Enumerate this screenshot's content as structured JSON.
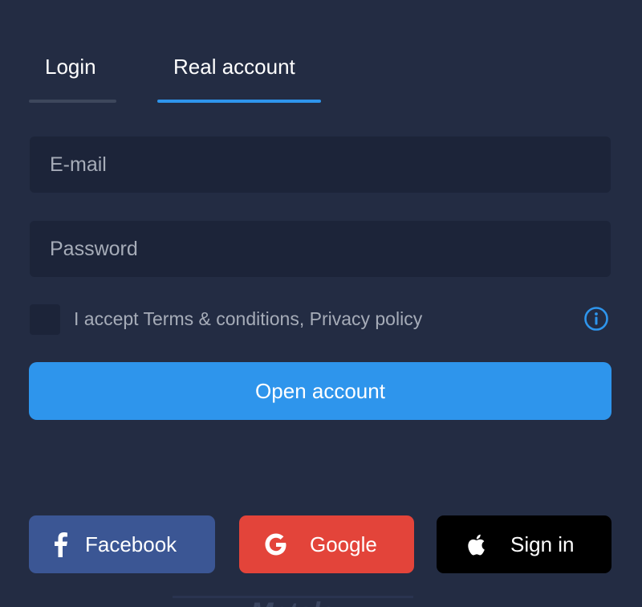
{
  "tabs": [
    {
      "label": "Login",
      "active": false
    },
    {
      "label": "Real account",
      "active": true
    }
  ],
  "form": {
    "email": {
      "placeholder": "E-mail",
      "value": ""
    },
    "password": {
      "placeholder": "Password",
      "value": ""
    },
    "terms": {
      "label": "I accept Terms & conditions, Privacy policy",
      "checked": false
    },
    "submit_label": "Open account"
  },
  "social": {
    "facebook": {
      "label": "Facebook",
      "icon": "facebook-icon",
      "color": "#3b5694"
    },
    "google": {
      "label": "Google",
      "icon": "google-icon",
      "color": "#e3443a"
    },
    "apple": {
      "label": "Sign in",
      "icon": "apple-icon",
      "color": "#000000"
    }
  },
  "colors": {
    "background": "#232c43",
    "accent": "#2e95ec",
    "input_bg": "#1c2439"
  },
  "bottom_peek_text": "Metals"
}
